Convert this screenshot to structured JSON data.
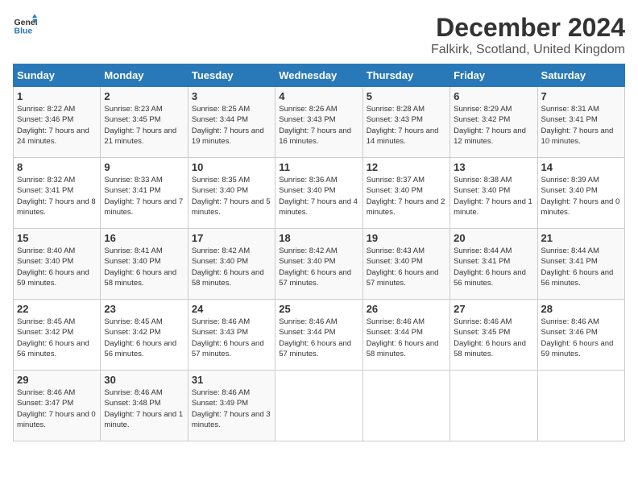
{
  "header": {
    "logo_general": "General",
    "logo_blue": "Blue",
    "title": "December 2024",
    "subtitle": "Falkirk, Scotland, United Kingdom"
  },
  "days_of_week": [
    "Sunday",
    "Monday",
    "Tuesday",
    "Wednesday",
    "Thursday",
    "Friday",
    "Saturday"
  ],
  "weeks": [
    [
      {
        "day": "1",
        "sunrise": "Sunrise: 8:22 AM",
        "sunset": "Sunset: 3:46 PM",
        "daylight": "Daylight: 7 hours and 24 minutes."
      },
      {
        "day": "2",
        "sunrise": "Sunrise: 8:23 AM",
        "sunset": "Sunset: 3:45 PM",
        "daylight": "Daylight: 7 hours and 21 minutes."
      },
      {
        "day": "3",
        "sunrise": "Sunrise: 8:25 AM",
        "sunset": "Sunset: 3:44 PM",
        "daylight": "Daylight: 7 hours and 19 minutes."
      },
      {
        "day": "4",
        "sunrise": "Sunrise: 8:26 AM",
        "sunset": "Sunset: 3:43 PM",
        "daylight": "Daylight: 7 hours and 16 minutes."
      },
      {
        "day": "5",
        "sunrise": "Sunrise: 8:28 AM",
        "sunset": "Sunset: 3:43 PM",
        "daylight": "Daylight: 7 hours and 14 minutes."
      },
      {
        "day": "6",
        "sunrise": "Sunrise: 8:29 AM",
        "sunset": "Sunset: 3:42 PM",
        "daylight": "Daylight: 7 hours and 12 minutes."
      },
      {
        "day": "7",
        "sunrise": "Sunrise: 8:31 AM",
        "sunset": "Sunset: 3:41 PM",
        "daylight": "Daylight: 7 hours and 10 minutes."
      }
    ],
    [
      {
        "day": "8",
        "sunrise": "Sunrise: 8:32 AM",
        "sunset": "Sunset: 3:41 PM",
        "daylight": "Daylight: 7 hours and 8 minutes."
      },
      {
        "day": "9",
        "sunrise": "Sunrise: 8:33 AM",
        "sunset": "Sunset: 3:41 PM",
        "daylight": "Daylight: 7 hours and 7 minutes."
      },
      {
        "day": "10",
        "sunrise": "Sunrise: 8:35 AM",
        "sunset": "Sunset: 3:40 PM",
        "daylight": "Daylight: 7 hours and 5 minutes."
      },
      {
        "day": "11",
        "sunrise": "Sunrise: 8:36 AM",
        "sunset": "Sunset: 3:40 PM",
        "daylight": "Daylight: 7 hours and 4 minutes."
      },
      {
        "day": "12",
        "sunrise": "Sunrise: 8:37 AM",
        "sunset": "Sunset: 3:40 PM",
        "daylight": "Daylight: 7 hours and 2 minutes."
      },
      {
        "day": "13",
        "sunrise": "Sunrise: 8:38 AM",
        "sunset": "Sunset: 3:40 PM",
        "daylight": "Daylight: 7 hours and 1 minute."
      },
      {
        "day": "14",
        "sunrise": "Sunrise: 8:39 AM",
        "sunset": "Sunset: 3:40 PM",
        "daylight": "Daylight: 7 hours and 0 minutes."
      }
    ],
    [
      {
        "day": "15",
        "sunrise": "Sunrise: 8:40 AM",
        "sunset": "Sunset: 3:40 PM",
        "daylight": "Daylight: 6 hours and 59 minutes."
      },
      {
        "day": "16",
        "sunrise": "Sunrise: 8:41 AM",
        "sunset": "Sunset: 3:40 PM",
        "daylight": "Daylight: 6 hours and 58 minutes."
      },
      {
        "day": "17",
        "sunrise": "Sunrise: 8:42 AM",
        "sunset": "Sunset: 3:40 PM",
        "daylight": "Daylight: 6 hours and 58 minutes."
      },
      {
        "day": "18",
        "sunrise": "Sunrise: 8:42 AM",
        "sunset": "Sunset: 3:40 PM",
        "daylight": "Daylight: 6 hours and 57 minutes."
      },
      {
        "day": "19",
        "sunrise": "Sunrise: 8:43 AM",
        "sunset": "Sunset: 3:40 PM",
        "daylight": "Daylight: 6 hours and 57 minutes."
      },
      {
        "day": "20",
        "sunrise": "Sunrise: 8:44 AM",
        "sunset": "Sunset: 3:41 PM",
        "daylight": "Daylight: 6 hours and 56 minutes."
      },
      {
        "day": "21",
        "sunrise": "Sunrise: 8:44 AM",
        "sunset": "Sunset: 3:41 PM",
        "daylight": "Daylight: 6 hours and 56 minutes."
      }
    ],
    [
      {
        "day": "22",
        "sunrise": "Sunrise: 8:45 AM",
        "sunset": "Sunset: 3:42 PM",
        "daylight": "Daylight: 6 hours and 56 minutes."
      },
      {
        "day": "23",
        "sunrise": "Sunrise: 8:45 AM",
        "sunset": "Sunset: 3:42 PM",
        "daylight": "Daylight: 6 hours and 56 minutes."
      },
      {
        "day": "24",
        "sunrise": "Sunrise: 8:46 AM",
        "sunset": "Sunset: 3:43 PM",
        "daylight": "Daylight: 6 hours and 57 minutes."
      },
      {
        "day": "25",
        "sunrise": "Sunrise: 8:46 AM",
        "sunset": "Sunset: 3:44 PM",
        "daylight": "Daylight: 6 hours and 57 minutes."
      },
      {
        "day": "26",
        "sunrise": "Sunrise: 8:46 AM",
        "sunset": "Sunset: 3:44 PM",
        "daylight": "Daylight: 6 hours and 58 minutes."
      },
      {
        "day": "27",
        "sunrise": "Sunrise: 8:46 AM",
        "sunset": "Sunset: 3:45 PM",
        "daylight": "Daylight: 6 hours and 58 minutes."
      },
      {
        "day": "28",
        "sunrise": "Sunrise: 8:46 AM",
        "sunset": "Sunset: 3:46 PM",
        "daylight": "Daylight: 6 hours and 59 minutes."
      }
    ],
    [
      {
        "day": "29",
        "sunrise": "Sunrise: 8:46 AM",
        "sunset": "Sunset: 3:47 PM",
        "daylight": "Daylight: 7 hours and 0 minutes."
      },
      {
        "day": "30",
        "sunrise": "Sunrise: 8:46 AM",
        "sunset": "Sunset: 3:48 PM",
        "daylight": "Daylight: 7 hours and 1 minute."
      },
      {
        "day": "31",
        "sunrise": "Sunrise: 8:46 AM",
        "sunset": "Sunset: 3:49 PM",
        "daylight": "Daylight: 7 hours and 3 minutes."
      },
      null,
      null,
      null,
      null
    ]
  ]
}
